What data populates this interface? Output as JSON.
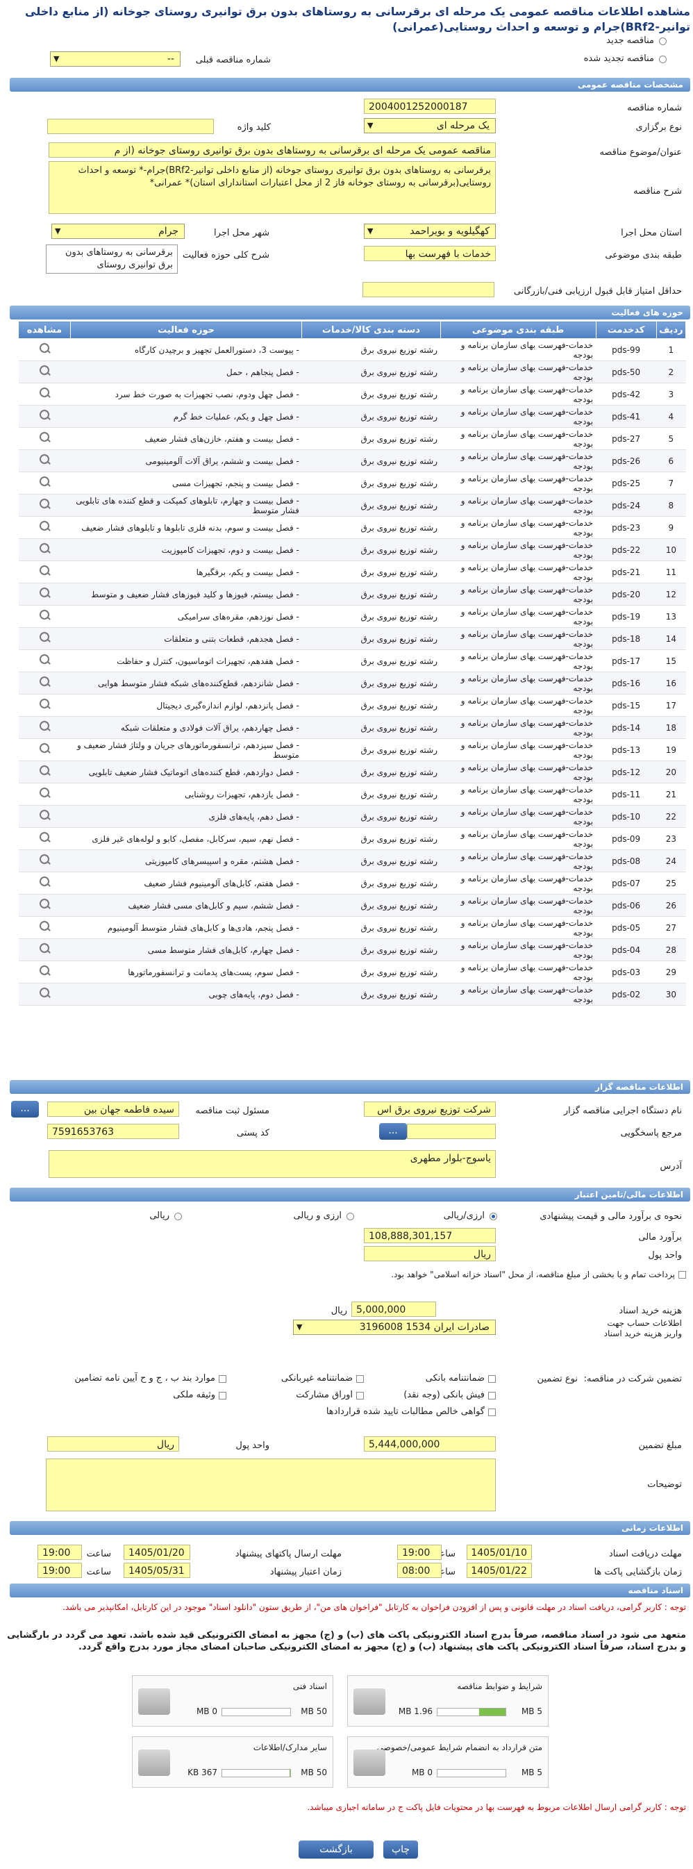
{
  "page": {
    "title": "مشاهده اطلاعات مناقصه عمومی یک مرحله ای برقرسانی به روستاهای بدون برق توانیری روستای جوخانه (از منابع داخلی توانیر-BRf2)جرام و توسعه و احداث روستایی(عمرانی)"
  },
  "top": {
    "radio_new": "مناقصه جدید",
    "radio_renewed": "مناقصه تجدید شده",
    "previous_label": "شماره مناقصه قبلی",
    "previous_value": "--"
  },
  "general": {
    "header": "مشخصات مناقصه عمومی",
    "number_label": "شماره مناقصه",
    "number_value": "2004001252000187",
    "type_label": "نوع برگزاری",
    "type_value": "یک مرحله ای",
    "keyword_label": "کلید واژه",
    "keyword_value": "",
    "subject_label": "عنوان/موضوع مناقصه",
    "subject_value": "مناقصه عمومی یک مرحله ای برقرسانی به روستاهای بدون برق توانیری روستای جوخانه (از م",
    "desc_label": "شرح مناقصه",
    "desc_value": "برقرسانی به روستاهای بدون برق توانیری روستای جوخانه (از منابع داخلی توانیر-BRf2)جرام-* توسعه و احداث روستایی(برقرسانی به روستای جوخانه فاز 2 از محل اعتبارات استاندارای استان)* عمرانی*",
    "province_label": "استان محل اجرا",
    "province_value": "کهگیلویه و بویراحمد",
    "city_label": "شهر محل اجرا",
    "city_value": "جرام",
    "category_label": "طبقه بندی موضوعی",
    "category_value": "خدمات با فهرست بها",
    "scope_label": "شرح کلی حوزه فعالیت",
    "scope_value": "برقرسانی به روستاهای بدون برق توانیری روستای",
    "min_score_label": "حداقل امتیاز قابل قبول ارزیابی فنی/بازرگانی",
    "min_score_value": ""
  },
  "activities": {
    "header": "حوزه های فعالیت",
    "columns": [
      "ردیف",
      "کدخدمت",
      "طبقه بندی موضوعی",
      "دسته بندی کالا/خدمات",
      "حوزه فعالیت",
      "مشاهده"
    ],
    "rows": [
      [
        "1",
        "pds-99",
        "خدمات-فهرست بهای سازمان برنامه و بودجه",
        "رشته توزیع نیروی برق",
        "- پیوست 3، دستورالعمل تجهیز و برچیدن کارگاه"
      ],
      [
        "2",
        "pds-50",
        "خدمات-فهرست بهای سازمان برنامه و بودجه",
        "رشته توزیع نیروی برق",
        "- فصل پنجاهم ، حمل"
      ],
      [
        "3",
        "pds-42",
        "خدمات-فهرست بهای سازمان برنامه و بودجه",
        "رشته توزیع نیروی برق",
        "- فصل چهل ودوم، نصب تجهیزات به صورت خط سرد"
      ],
      [
        "4",
        "pds-41",
        "خدمات-فهرست بهای سازمان برنامه و بودجه",
        "رشته توزیع نیروی برق",
        "- فصل چهل و یکم، عملیات خط گرم"
      ],
      [
        "5",
        "pds-27",
        "خدمات-فهرست بهای سازمان برنامه و بودجه",
        "رشته توزیع نیروی برق",
        "- فصل بیست و هفتم، خازن‌های فشار ضعیف"
      ],
      [
        "6",
        "pds-26",
        "خدمات-فهرست بهای سازمان برنامه و بودجه",
        "رشته توزیع نیروی برق",
        "- فصل بیست و ششم، یراق آلات آلومینیومی"
      ],
      [
        "7",
        "pds-25",
        "خدمات-فهرست بهای سازمان برنامه و بودجه",
        "رشته توزیع نیروی برق",
        "- فصل بیست و پنجم، تجهیزات مسی"
      ],
      [
        "8",
        "pds-24",
        "خدمات-فهرست بهای سازمان برنامه و بودجه",
        "رشته توزیع نیروی برق",
        "- فصل بیست و چهارم، تابلوهای کمپکت و قطع کننده های تابلویی فشار متوسط"
      ],
      [
        "9",
        "pds-23",
        "خدمات-فهرست بهای سازمان برنامه و بودجه",
        "رشته توزیع نیروی برق",
        "- فصل بیست و سوم، بدنه فلزی تابلوها و تابلوهای فشار ضعیف"
      ],
      [
        "10",
        "pds-22",
        "خدمات-فهرست بهای سازمان برنامه و بودجه",
        "رشته توزیع نیروی برق",
        "- فصل بیست و دوم، تجهیزات کامپوزیت"
      ],
      [
        "11",
        "pds-21",
        "خدمات-فهرست بهای سازمان برنامه و بودجه",
        "رشته توزیع نیروی برق",
        "- فصل بیست و یکم، برقگیرها"
      ],
      [
        "12",
        "pds-20",
        "خدمات-فهرست بهای سازمان برنامه و بودجه",
        "رشته توزیع نیروی برق",
        "- فصل بیستم، فیوزها و کلید فیوزهای فشار ضعیف و متوسط"
      ],
      [
        "13",
        "pds-19",
        "خدمات-فهرست بهای سازمان برنامه و بودجه",
        "رشته توزیع نیروی برق",
        "- فصل نوزدهم، مقره‌های سرامیکی"
      ],
      [
        "14",
        "pds-18",
        "خدمات-فهرست بهای سازمان برنامه و بودجه",
        "رشته توزیع نیروی برق",
        "- فصل هجدهم، قطعات بتنی و متعلقات"
      ],
      [
        "15",
        "pds-17",
        "خدمات-فهرست بهای سازمان برنامه و بودجه",
        "رشته توزیع نیروی برق",
        "- فصل هفدهم، تجهیزات اتوماسیون، کنترل و حفاظت"
      ],
      [
        "16",
        "pds-16",
        "خدمات-فهرست بهای سازمان برنامه و بودجه",
        "رشته توزیع نیروی برق",
        "- فصل شانزدهم، قطع‌کننده‌های شبکه فشار متوسط هوایی"
      ],
      [
        "17",
        "pds-15",
        "خدمات-فهرست بهای سازمان برنامه و بودجه",
        "رشته توزیع نیروی برق",
        "- فصل پانزدهم، لوازم اندازه‌گیری دیجیتال"
      ],
      [
        "18",
        "pds-14",
        "خدمات-فهرست بهای سازمان برنامه و بودجه",
        "رشته توزیع نیروی برق",
        "- فصل چهاردهم، یراق آلات فولادی و متعلقات شبکه"
      ],
      [
        "19",
        "pds-13",
        "خدمات-فهرست بهای سازمان برنامه و بودجه",
        "رشته توزیع نیروی برق",
        "- فصل سیزدهم، ترانسفورماتورهای جریان و ولتاژ فشار ضعیف و متوسط"
      ],
      [
        "20",
        "pds-12",
        "خدمات-فهرست بهای سازمان برنامه و بودجه",
        "رشته توزیع نیروی برق",
        "- فصل دوازدهم، قطع کننده‌های اتوماتیک فشار ضعیف تابلویی"
      ],
      [
        "21",
        "pds-11",
        "خدمات-فهرست بهای سازمان برنامه و بودجه",
        "رشته توزیع نیروی برق",
        "- فصل یازدهم، تجهیزات روشنایی"
      ],
      [
        "22",
        "pds-10",
        "خدمات-فهرست بهای سازمان برنامه و بودجه",
        "رشته توزیع نیروی برق",
        "- فصل دهم، پایه‌های فلزی"
      ],
      [
        "23",
        "pds-09",
        "خدمات-فهرست بهای سازمان برنامه و بودجه",
        "رشته توزیع نیروی برق",
        "- فصل نهم، سیم، سرکابل، مفصل، کابو و لوله‌های غیر فلزی"
      ],
      [
        "24",
        "pds-08",
        "خدمات-فهرست بهای سازمان برنامه و بودجه",
        "رشته توزیع نیروی برق",
        "- فصل هشتم، مقره و اسپیسرهای کامپوزیتی"
      ],
      [
        "25",
        "pds-07",
        "خدمات-فهرست بهای سازمان برنامه و بودجه",
        "رشته توزیع نیروی برق",
        "- فصل هفتم، کابل‌های آلومینیوم فشار ضعیف"
      ],
      [
        "26",
        "pds-06",
        "خدمات-فهرست بهای سازمان برنامه و بودجه",
        "رشته توزیع نیروی برق",
        "- فصل ششم، سیم و کابل‌های مسی فشار ضعیف"
      ],
      [
        "27",
        "pds-05",
        "خدمات-فهرست بهای سازمان برنامه و بودجه",
        "رشته توزیع نیروی برق",
        "- فصل پنجم، هادی‌ها و کابل‌های فشار متوسط آلومینیوم"
      ],
      [
        "28",
        "pds-04",
        "خدمات-فهرست بهای سازمان برنامه و بودجه",
        "رشته توزیع نیروی برق",
        "- فصل چهارم، کابل‌های فشار متوسط مسی"
      ],
      [
        "29",
        "pds-03",
        "خدمات-فهرست بهای سازمان برنامه و بودجه",
        "رشته توزیع نیروی برق",
        "- فصل سوم، پست‌های پدمانت و ترانسفورماتورها"
      ],
      [
        "30",
        "pds-02",
        "خدمات-فهرست بهای سازمان برنامه و بودجه",
        "رشته توزیع نیروی برق",
        "- فصل دوم، پایه‌های چوبی"
      ]
    ]
  },
  "organizer": {
    "header": "اطلاعات مناقصه گزار",
    "org_label": "نام دستگاه اجرایی مناقصه گزار",
    "org_value": "شرکت توزیع نیروی برق اس",
    "responsible_label": "مسئول ثبت مناقصه",
    "responsible_value": "سیده فاطمه جهان بین",
    "ref_label": "مرجع پاسخگویی",
    "ref_value": "",
    "postal_label": "کد پستی",
    "postal_value": "7591653763",
    "address_label": "آدرس",
    "address_value": "یاسوج-بلوار مطهری",
    "dots": "..."
  },
  "finance": {
    "header": "اطلاعات مالی/تامین اعتبار",
    "estimate_label": "نحوه ی برآورد مالی و قیمت پیشنهادی",
    "opt_rial_fx": "ارزی/ریالی",
    "opt_fx_rial": "ارزی و ریالی",
    "opt_rial": "ریالی",
    "estimate_amount_label": "برآورد مالی",
    "estimate_amount_value": "108,888,301,157",
    "currency_label": "واحد پول",
    "currency_value": "ریال",
    "treasury_text": "پرداخت تمام و یا بخشی از مبلغ مناقصه، از محل \"اسناد خزانه اسلامی\" خواهد بود.",
    "doc_cost_label": "هزینه خرید اسناد",
    "doc_cost_value": "5,000,000",
    "doc_cost_unit": "ریال",
    "account_label": "اطلاعات حساب جهت واریز هزینه خرید اسناد",
    "account_value": "صادرات ایران 1534 3196008",
    "participation_label": "تضمین شرکت در مناقصه:",
    "guarantee_type_label": "نوع تضمین",
    "g_bank": "ضمانتنامه بانکی",
    "g_nonbank": "ضمانتنامه غیربانکی",
    "g_clauses": "موارد بند ب ، ج و ح آیین نامه تضامین",
    "g_cheque": "فیش بانکی (وجه نقد)",
    "g_shares": "اوراق مشارکت",
    "g_property": "وثیقه ملکی",
    "g_claims": "گواهی خالص مطالبات تایید شده قراردادها",
    "amount_label": "مبلغ تضمین",
    "amount_value": "5,444,000,000",
    "amount_currency_label": "واحد پول",
    "amount_currency_value": "ریال",
    "notes_label": "توضیحات",
    "notes_value": ""
  },
  "timing": {
    "header": "اطلاعات زمانی",
    "doc_receive_label": "مهلت دریافت اسناد",
    "doc_receive_date": "1405/01/10",
    "doc_receive_time_label": "ساعت",
    "doc_receive_time": "19:00",
    "bid_send_label": "مهلت ارسال پاکتهای پیشنهاد",
    "bid_send_date": "1405/01/20",
    "bid_send_time_label": "ساعت",
    "bid_send_time": "19:00",
    "opening_label": "زمان بازگشایی پاکت ها",
    "opening_date": "1405/01/22",
    "opening_time_label": "ساعت",
    "opening_time": "08:00",
    "validity_label": "زمان اعتبار پیشنهاد",
    "validity_date": "1405/05/31",
    "validity_time_label": "ساعت",
    "validity_time": "19:00"
  },
  "documents": {
    "header": "اسناد مناقصه",
    "note_red": "توجه : کاربر گرامی، دریافت اسناد در مهلت قانونی و پس از افزودن فراخوان به کارتابل \"فراخوان های من\"، از طریق ستون \"دانلود اسناد\" موجود در این کارتابل، امکانپذیر می باشد.",
    "note_bold": "متعهد می شود در اسناد مناقصه، صرفاً بدرج اسناد الکترونیکی پاکت های (ب) و (ج) مجهز به امضای الکترونیکی قید شده باشد. تعهد می گردد در بارگشایی و بدرج اسناد، صرفاً اسناد الکترونیکی پاکت های پیشنهاد (ب) و (ج) مجهز به امضای الکترونیکی صاحبان امضای مجاز مورد بدرج واقع گردد.",
    "boxes": [
      {
        "title": "شرایط و ضوابط مناقصه",
        "used": "1.96 MB",
        "max": "5 MB",
        "fill": 0.39
      },
      {
        "title": "اسناد فنی",
        "used": "0 MB",
        "max": "50 MB",
        "fill": 0
      },
      {
        "title": "متن قرارداد به انضمام شرایط عمومی/خصوصی",
        "used": "0 MB",
        "max": "5 MB",
        "fill": 0
      },
      {
        "title": "سایر مدارک/اطلاعات",
        "used": "367 KB",
        "max": "50 MB",
        "fill": 0.007
      }
    ],
    "footer_note": "توجه : کاربر گرامی ارسال اطلاعات مربوط به فهرست بها در محتویات فایل پاکت ج در سامانه اجباری میباشد."
  },
  "actions": {
    "print": "چاپ",
    "back": "بازگشت"
  }
}
